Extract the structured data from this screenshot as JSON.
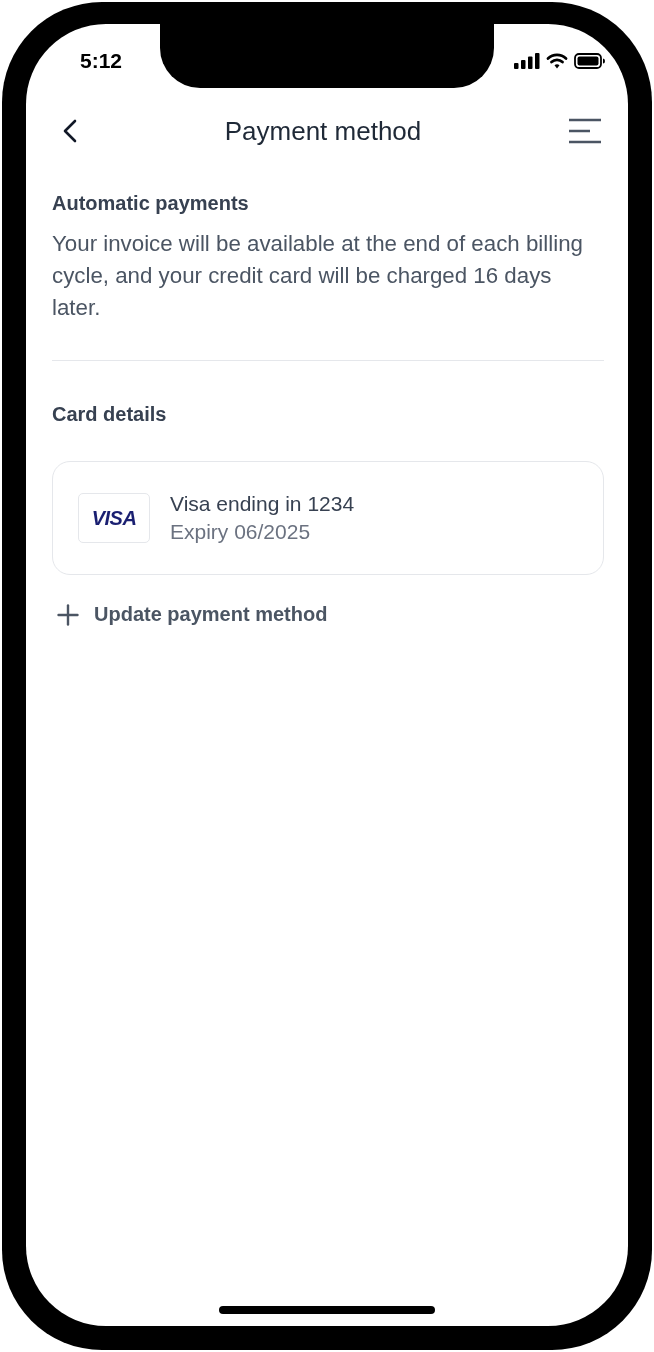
{
  "status_bar": {
    "time": "5:12"
  },
  "header": {
    "title": "Payment method"
  },
  "automatic_payments": {
    "heading": "Automatic payments",
    "text": "Your invoice will be available at the end of each billing cycle, and your credit card will be charged 16 days later."
  },
  "card_details": {
    "heading": "Card details",
    "card": {
      "brand": "VISA",
      "name": "Visa ending in 1234",
      "expiry": "Expiry 06/2025"
    }
  },
  "update_link": {
    "label": "Update payment method"
  }
}
